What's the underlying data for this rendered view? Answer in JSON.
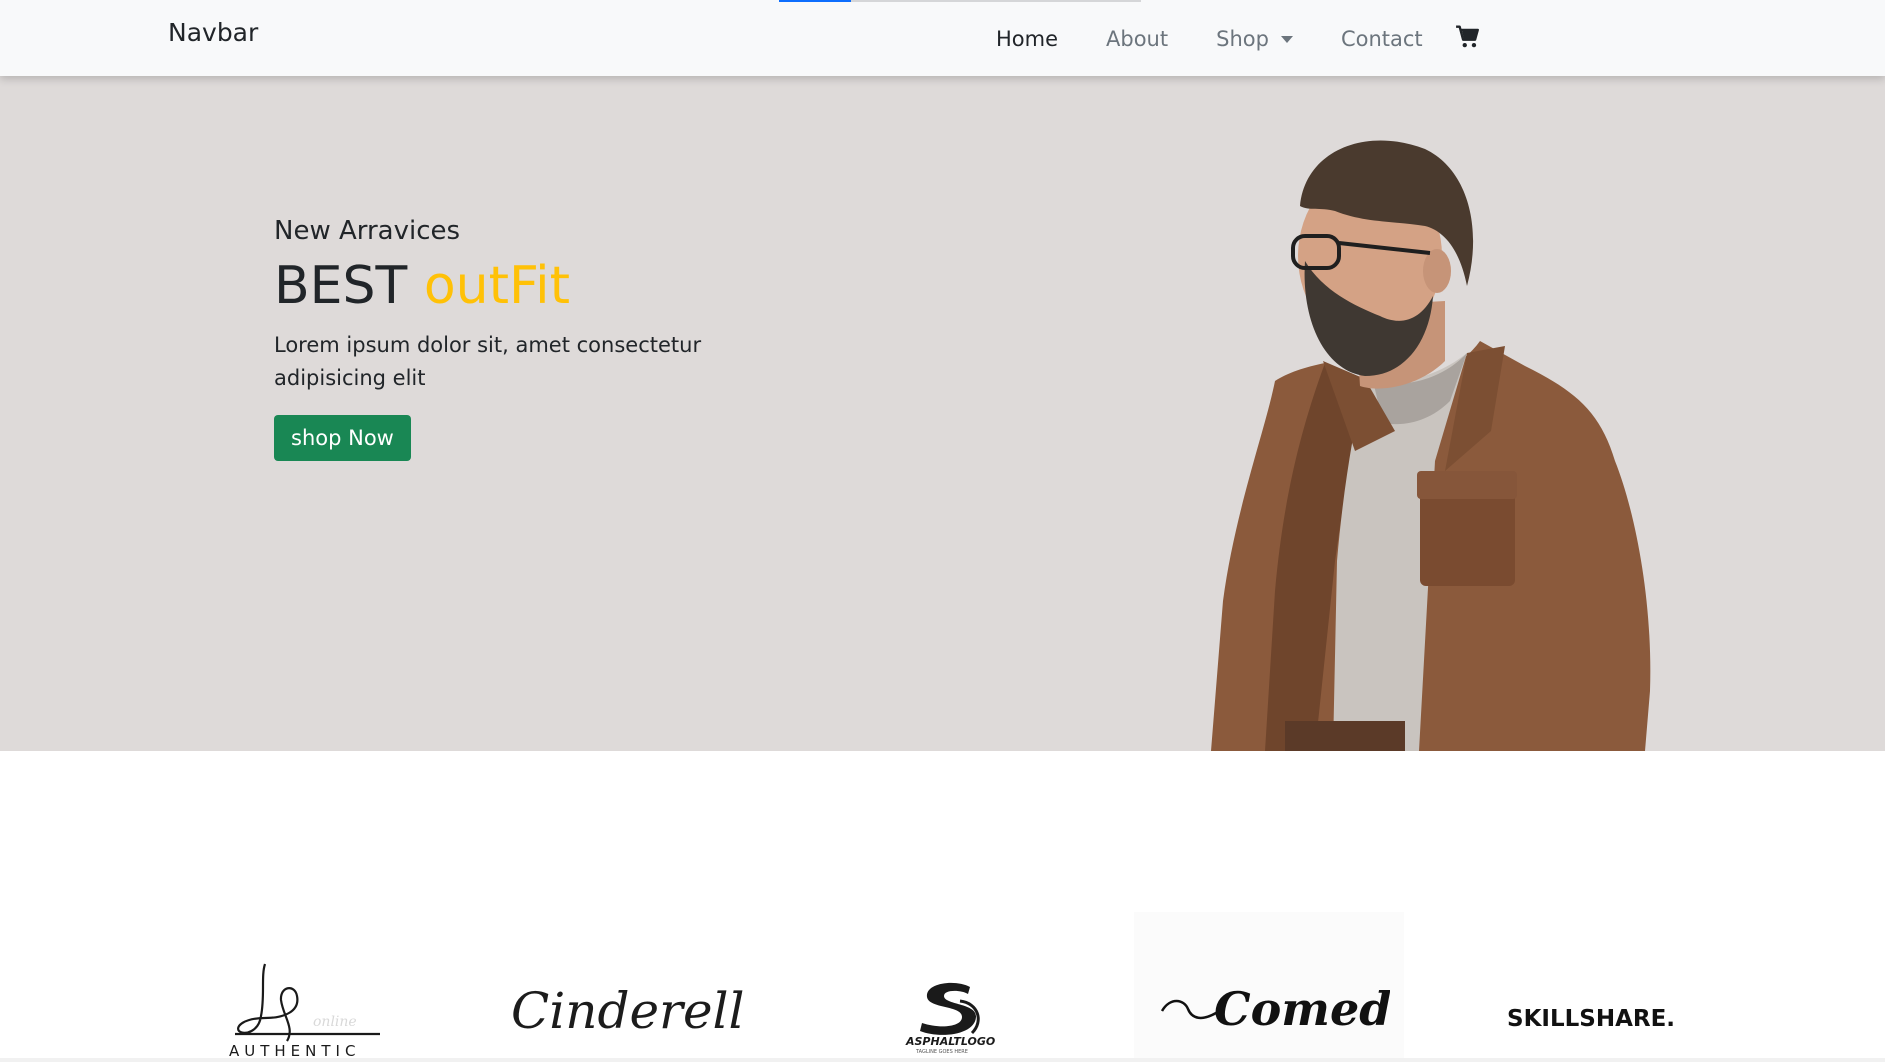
{
  "navbar": {
    "brand": "Navbar",
    "links": [
      {
        "label": "Home",
        "active": true
      },
      {
        "label": "About"
      },
      {
        "label": "Shop",
        "dropdown": true
      },
      {
        "label": "Contact"
      }
    ],
    "cart_icon": "shopping-cart-icon"
  },
  "hero": {
    "subtitle": "New Arravices",
    "headline_main": "BEST",
    "headline_accent": "outFit",
    "description": "Lorem ipsum dolor sit, amet consectetur adipisicing elit",
    "button": "shop Now",
    "image": "man-in-brown-jacket-photo"
  },
  "brands": [
    {
      "name": "authentic",
      "text": "AUTHENTIC",
      "sub": "online"
    },
    {
      "name": "cinderella",
      "text": "Cinderella"
    },
    {
      "name": "asphalt",
      "text": "ASPHALTLOGO",
      "sub": "TAGLINE GOES HERE"
    },
    {
      "name": "comedy",
      "text": "Comedy"
    },
    {
      "name": "skillshare",
      "text": "SKILLSHARE."
    }
  ],
  "colors": {
    "accent": "#ffc107",
    "button": "#198754",
    "hero_bg": "#dedad9",
    "navbar_bg": "#f8f9fa"
  }
}
